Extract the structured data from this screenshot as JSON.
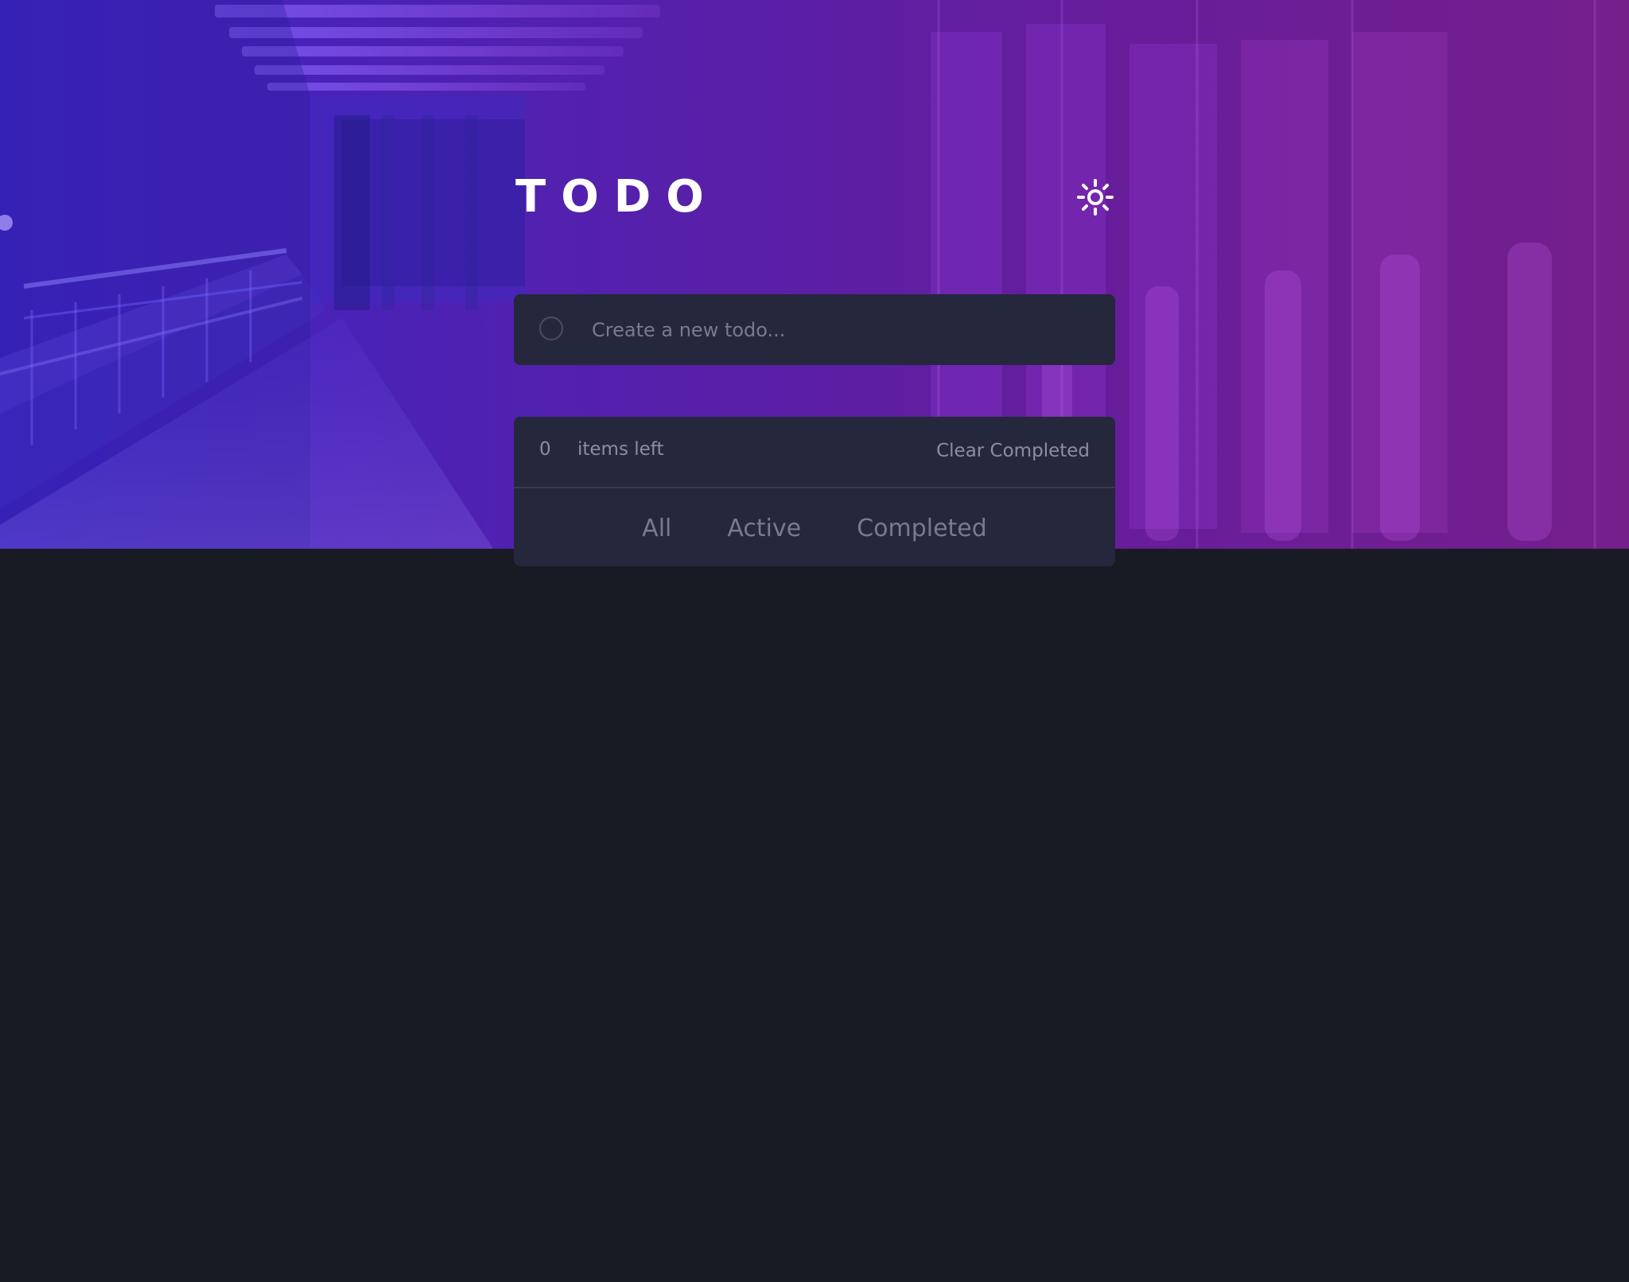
{
  "app": {
    "title": "TODO",
    "theme_toggle_icon": "sun-icon"
  },
  "new_todo": {
    "placeholder": "Create a new todo..."
  },
  "summary": {
    "count": "0",
    "label": "items left",
    "clear_label": "Clear Completed"
  },
  "filters": [
    {
      "label": "All"
    },
    {
      "label": "Active"
    },
    {
      "label": "Completed"
    }
  ],
  "colors": {
    "page_background": "#181a24",
    "panel_background": "#25273c",
    "hero_left": "#3b25c8",
    "hero_right": "#7a1f86",
    "title_text": "#ffffff",
    "muted_text": "#8a8da6"
  }
}
